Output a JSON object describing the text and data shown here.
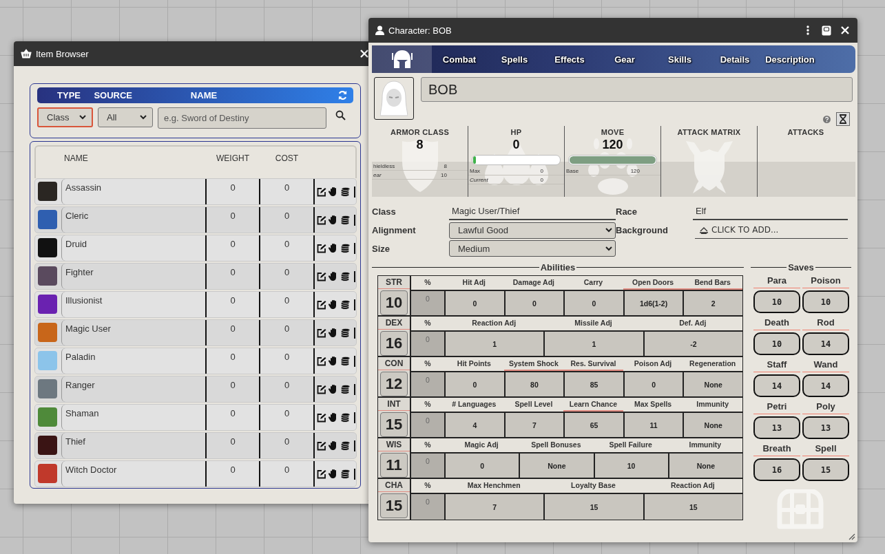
{
  "item_browser": {
    "title": "Item Browser",
    "filter_headers": [
      "TYPE",
      "SOURCE",
      "NAME"
    ],
    "type_filter": "Class",
    "source_filter": "All",
    "name_placeholder": "e.g. Sword of Destiny",
    "columns": [
      "NAME",
      "WEIGHT",
      "COST"
    ],
    "rows": [
      {
        "name": "Assassin",
        "weight": "0",
        "cost": "0",
        "color": "#2a2622"
      },
      {
        "name": "Cleric",
        "weight": "0",
        "cost": "0",
        "color": "#2f5fb0"
      },
      {
        "name": "Druid",
        "weight": "0",
        "cost": "0",
        "color": "#111111"
      },
      {
        "name": "Fighter",
        "weight": "0",
        "cost": "0",
        "color": "#5a4a5e"
      },
      {
        "name": "Illusionist",
        "weight": "0",
        "cost": "0",
        "color": "#6a22b0"
      },
      {
        "name": "Magic User",
        "weight": "0",
        "cost": "0",
        "color": "#c8661a"
      },
      {
        "name": "Paladin",
        "weight": "0",
        "cost": "0",
        "color": "#8cc4ea"
      },
      {
        "name": "Ranger",
        "weight": "0",
        "cost": "0",
        "color": "#6d7880"
      },
      {
        "name": "Shaman",
        "weight": "0",
        "cost": "0",
        "color": "#4f8a3a"
      },
      {
        "name": "Thief",
        "weight": "0",
        "cost": "0",
        "color": "#3a1414"
      },
      {
        "name": "Witch Doctor",
        "weight": "0",
        "cost": "0",
        "color": "#c0392b"
      }
    ]
  },
  "character": {
    "title": "Character: BOB",
    "tabs": [
      {
        "kind": "icon",
        "selected": true
      },
      {
        "kind": "text",
        "label": "Combat",
        "selected": false
      },
      {
        "kind": "text",
        "label": "Spells",
        "selected": false
      },
      {
        "kind": "text",
        "label": "Effects",
        "selected": false
      },
      {
        "kind": "text",
        "label": "Gear",
        "selected": false
      },
      {
        "kind": "text",
        "label": "Skills",
        "selected": false
      },
      {
        "kind": "text",
        "label": "Details",
        "selected": false
      },
      {
        "kind": "text",
        "label": "Description",
        "selected": false
      }
    ],
    "name": "BOB",
    "stats": [
      {
        "kind": "ac",
        "label": "ARMOR CLASS",
        "value": "8",
        "rows": [
          {
            "label": "hieldless",
            "value": "8",
            "italic": false
          },
          {
            "label": "ear",
            "value": "10",
            "italic": true
          }
        ]
      },
      {
        "kind": "hp",
        "label": "HP",
        "value": "0",
        "level": 0.03,
        "rows": [
          {
            "label": "Max",
            "value": "0",
            "italic": false
          },
          {
            "label": "Current",
            "value": "0",
            "italic": true
          }
        ]
      },
      {
        "kind": "move",
        "label": "MOVE",
        "value": "120",
        "level": 1,
        "rows": [
          {
            "label": "Base",
            "value": "120",
            "italic": false
          }
        ]
      },
      {
        "kind": "matrix",
        "label": "ATTACK MATRIX"
      },
      {
        "kind": "empty",
        "label": "ATTACKS"
      }
    ],
    "details": [
      {
        "kind": "text",
        "label": "Class",
        "value": "Magic User/Thief"
      },
      {
        "kind": "text",
        "label": "Race",
        "value": "Elf"
      },
      {
        "kind": "select",
        "label": "Alignment",
        "value": "Lawful Good"
      },
      {
        "kind": "add",
        "label": "Background",
        "value": "CLICK TO ADD..."
      },
      {
        "kind": "select",
        "label": "Size",
        "value": "Medium"
      }
    ],
    "abilities": {
      "title": "Abilities",
      "rows": [
        {
          "abbr": "STR",
          "score": "10",
          "percent_label": "%",
          "percent": "0",
          "columns": [
            {
              "label": "Hit Adj",
              "value": "0",
              "highlighted": false
            },
            {
              "label": "Damage Adj",
              "value": "0",
              "highlighted": false
            },
            {
              "label": "Carry",
              "value": "0",
              "highlighted": false
            },
            {
              "label": "Open Doors",
              "value": "1d6(1-2)",
              "highlighted": true
            },
            {
              "label": "Bend Bars",
              "value": "2",
              "highlighted": true
            }
          ]
        },
        {
          "abbr": "DEX",
          "score": "16",
          "percent_label": "%",
          "percent": "0",
          "columns": [
            {
              "label": "Reaction Adj",
              "value": "1",
              "highlighted": false
            },
            {
              "label": "Missile Adj",
              "value": "1",
              "highlighted": false
            },
            {
              "label": "Def. Adj",
              "value": "-2",
              "highlighted": false
            }
          ]
        },
        {
          "abbr": "CON",
          "score": "12",
          "percent_label": "%",
          "percent": "0",
          "columns": [
            {
              "label": "Hit Points",
              "value": "0",
              "highlighted": false
            },
            {
              "label": "System Shock",
              "value": "80",
              "highlighted": true
            },
            {
              "label": "Res. Survival",
              "value": "85",
              "highlighted": true
            },
            {
              "label": "Poison Adj",
              "value": "0",
              "highlighted": false
            },
            {
              "label": "Regeneration",
              "value": "None",
              "highlighted": false
            }
          ]
        },
        {
          "abbr": "INT",
          "score": "15",
          "percent_label": "%",
          "percent": "0",
          "columns": [
            {
              "label": "# Languages",
              "value": "4",
              "highlighted": false
            },
            {
              "label": "Spell Level",
              "value": "7",
              "highlighted": false
            },
            {
              "label": "Learn Chance",
              "value": "65",
              "highlighted": true
            },
            {
              "label": "Max Spells",
              "value": "11",
              "highlighted": false
            },
            {
              "label": "Immunity",
              "value": "None",
              "highlighted": false
            }
          ]
        },
        {
          "abbr": "WIS",
          "score": "11",
          "percent_label": "%",
          "percent": "0",
          "columns": [
            {
              "label": "Magic Adj",
              "value": "0",
              "highlighted": false
            },
            {
              "label": "Spell Bonuses",
              "value": "None",
              "highlighted": false
            },
            {
              "label": "Spell Failure",
              "value": "10",
              "highlighted": false
            },
            {
              "label": "Immunity",
              "value": "None",
              "highlighted": false
            }
          ]
        },
        {
          "abbr": "CHA",
          "score": "15",
          "percent_label": "%",
          "percent": "0",
          "columns": [
            {
              "label": "Max Henchmen",
              "value": "7",
              "highlighted": false
            },
            {
              "label": "Loyalty Base",
              "value": "15",
              "highlighted": false
            },
            {
              "label": "Reaction Adj",
              "value": "15",
              "highlighted": false
            }
          ]
        }
      ]
    },
    "saves": {
      "title": "Saves",
      "items": [
        {
          "label": "Para",
          "value": "10"
        },
        {
          "label": "Poison",
          "value": "10"
        },
        {
          "label": "Death",
          "value": "10"
        },
        {
          "label": "Rod",
          "value": "14"
        },
        {
          "label": "Staff",
          "value": "14"
        },
        {
          "label": "Wand",
          "value": "14"
        },
        {
          "label": "Petri",
          "value": "13"
        },
        {
          "label": "Poly",
          "value": "13"
        },
        {
          "label": "Breath",
          "value": "16"
        },
        {
          "label": "Spell",
          "value": "15"
        }
      ]
    }
  }
}
